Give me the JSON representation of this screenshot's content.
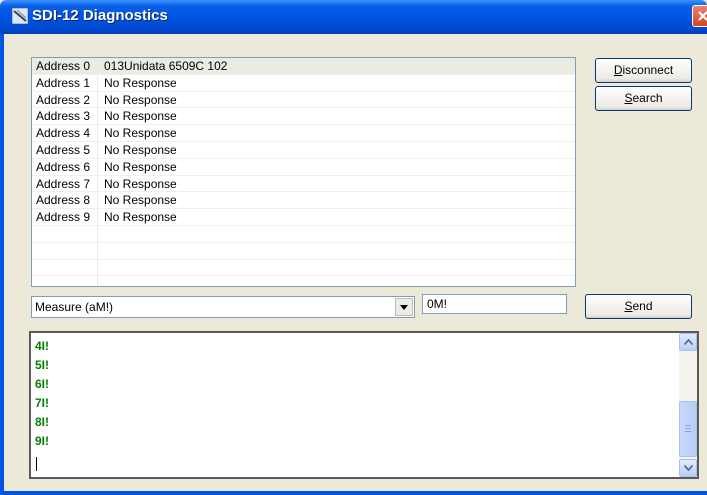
{
  "window": {
    "title": "SDI-12 Diagnostics"
  },
  "devices": [
    {
      "address": "Address 0",
      "response": "013Unidata 6509C 102"
    },
    {
      "address": "Address 1",
      "response": "No Response"
    },
    {
      "address": "Address 2",
      "response": "No Response"
    },
    {
      "address": "Address 3",
      "response": "No Response"
    },
    {
      "address": "Address 4",
      "response": "No Response"
    },
    {
      "address": "Address 5",
      "response": "No Response"
    },
    {
      "address": "Address 6",
      "response": "No Response"
    },
    {
      "address": "Address 7",
      "response": "No Response"
    },
    {
      "address": "Address 8",
      "response": "No Response"
    },
    {
      "address": "Address 9",
      "response": "No Response"
    }
  ],
  "buttons": {
    "disconnect_mnemonic": "D",
    "disconnect_rest": "isconnect",
    "search_mnemonic": "S",
    "search_rest": "earch",
    "send_mnemonic": "S",
    "send_rest": "end"
  },
  "command": {
    "selected": "Measure (aM!)",
    "value": "0M!"
  },
  "output": {
    "lines": [
      "4I!",
      "5I!",
      "6I!",
      "7I!",
      "8I!",
      "9I!"
    ]
  },
  "colors": {
    "output_text": "#008000",
    "titlebar": "#0054e3"
  }
}
